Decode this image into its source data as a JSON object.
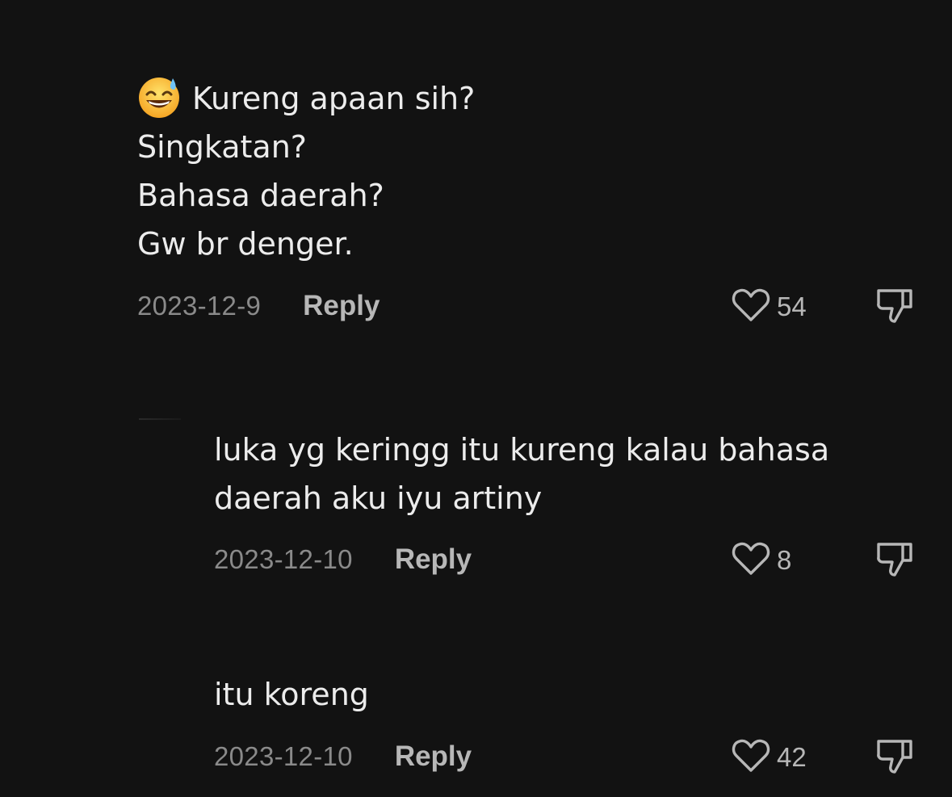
{
  "comments": [
    {
      "emoji": "grinning-sweat-emoji",
      "first_line": "Kureng apaan sih?",
      "rest": "Singkatan?\nBahasa daerah?\nGw br denger.",
      "date": "2023-12-9",
      "reply_label": "Reply",
      "likes": "54"
    },
    {
      "text": "luka yg keringg itu kureng kalau bahasa\ndaerah aku iyu artiny",
      "date": "2023-12-10",
      "reply_label": "Reply",
      "likes": "8"
    },
    {
      "text": "itu koreng",
      "date": "2023-12-10",
      "reply_label": "Reply",
      "likes": "42"
    }
  ],
  "icons": {
    "like": "heart-icon",
    "dislike": "thumbs-down-icon"
  },
  "colors": {
    "background": "#121212",
    "text": "#ececec",
    "meta": "#8a8a8a",
    "action": "#b7b7b7"
  }
}
